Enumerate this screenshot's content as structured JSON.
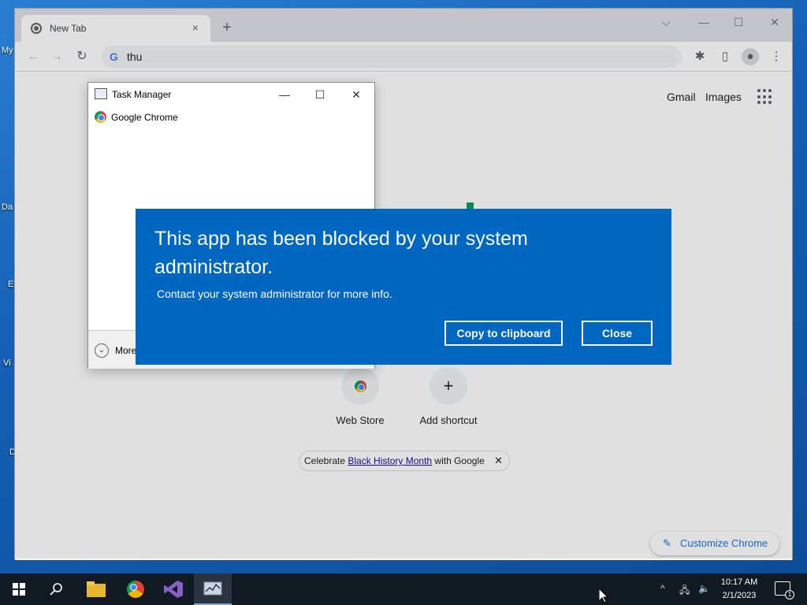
{
  "desktop": {
    "icon_labels": [
      "My",
      "Da",
      "E",
      "Vi",
      "D"
    ]
  },
  "browser": {
    "tab": {
      "title": "New Tab",
      "close": "×"
    },
    "new_tab": "+",
    "window_controls": {
      "dropdown": "⌵",
      "minimize": "—",
      "maximize": "☐",
      "close": "✕"
    },
    "nav": {
      "back": "←",
      "forward": "→",
      "reload": "↻"
    },
    "omnibox": {
      "g": "G",
      "value": "thu"
    },
    "header": {
      "gmail": "Gmail",
      "images": "Images"
    },
    "shortcuts": [
      {
        "label": "Web Store",
        "icon": "chrome-webstore-icon"
      },
      {
        "label": "Add shortcut",
        "icon": "plus-icon",
        "glyph": "+"
      }
    ],
    "promo": {
      "prefix": "Celebrate ",
      "link": "Black History Month",
      "suffix": " with Google",
      "close": "✕"
    },
    "customize": {
      "label": "Customize Chrome",
      "icon": "✎"
    }
  },
  "task_manager": {
    "title": "Task Manager",
    "controls": {
      "minimize": "—",
      "maximize": "☐",
      "close": "✕"
    },
    "processes": [
      "Google Chrome"
    ],
    "more_label": "More",
    "more_icon": "⌄"
  },
  "blocked_dialog": {
    "title": "This app has been blocked by your system administrator.",
    "message": "Contact your system administrator for more info.",
    "copy_button": "Copy to clipboard",
    "close_button": "Close",
    "color": "#0067c0"
  },
  "taskbar": {
    "items": [
      "start-icon",
      "search-icon",
      "file-explorer-icon",
      "chrome-icon",
      "visual-studio-icon",
      "task-manager-icon"
    ],
    "tray": {
      "chevron": "^",
      "volume": "🔈"
    },
    "time": "10:17 AM",
    "date": "2/1/2023",
    "notification_count": "1"
  }
}
